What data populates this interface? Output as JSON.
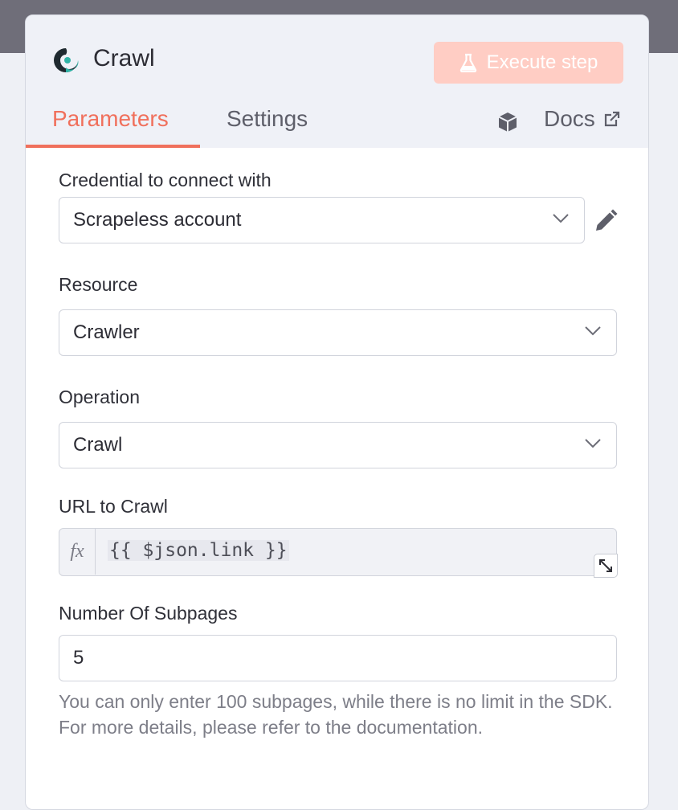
{
  "panel": {
    "title": "Crawl",
    "execute_label": "Execute step",
    "tabs": [
      {
        "label": "Parameters",
        "active": true
      },
      {
        "label": "Settings",
        "active": false
      }
    ],
    "docs_label": "Docs"
  },
  "form": {
    "credential": {
      "label": "Credential to connect with",
      "value": "Scrapeless account"
    },
    "resource": {
      "label": "Resource",
      "value": "Crawler"
    },
    "operation": {
      "label": "Operation",
      "value": "Crawl"
    },
    "url": {
      "label": "URL to Crawl",
      "fx": "fx",
      "expression": "{{ $json.link }}"
    },
    "subpages": {
      "label": "Number Of Subpages",
      "value": "5",
      "hint": "You can only enter 100 subpages, while there is no limit in the SDK. For more details, please refer to the documentation."
    }
  },
  "colors": {
    "accent": "#f0705c",
    "execute_bg": "#ffcdc4",
    "topbar": "#6f6e79"
  },
  "icons": [
    "scrapeless-logo-icon",
    "flask-icon",
    "cube-icon",
    "external-link-icon",
    "chevron-down-icon",
    "pencil-icon",
    "expand-icon"
  ]
}
